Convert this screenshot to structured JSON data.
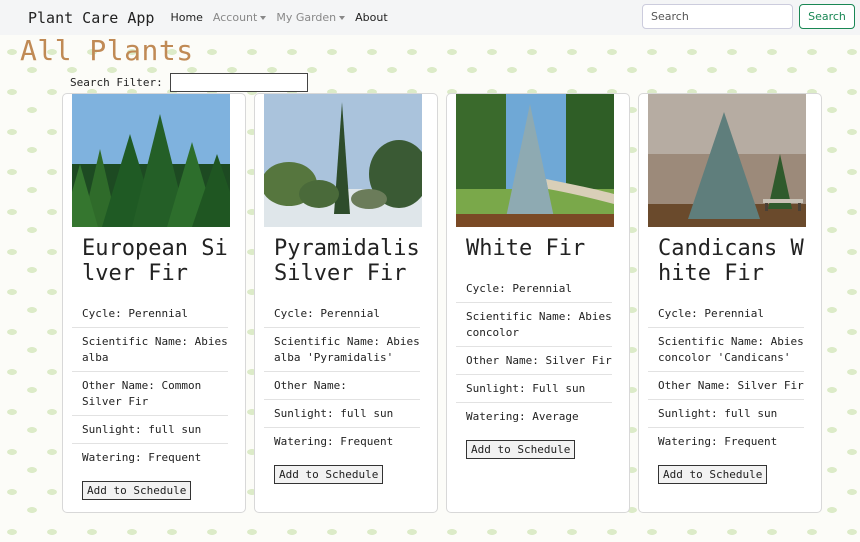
{
  "navbar": {
    "brand": "Plant Care App",
    "links": [
      {
        "label": "Home"
      },
      {
        "label": "Account"
      },
      {
        "label": "My Garden"
      },
      {
        "label": "About"
      }
    ],
    "search_placeholder": "Search",
    "search_button": "Search",
    "accent_color": "#198754"
  },
  "page": {
    "title": "All Plants",
    "title_color": "#c08a55",
    "filter_label": "Search Filter:",
    "filter_value": ""
  },
  "plants": [
    {
      "name": "European Silver Fir",
      "image_icon": "fir-forest-photo",
      "cycle": "Cycle: Perennial",
      "scientific": "Scientific Name: Abies alba",
      "other": "Other Name: Common Silver Fir",
      "sunlight": "Sunlight: full sun",
      "watering": "Watering: Frequent",
      "button": "Add to Schedule"
    },
    {
      "name": "Pyramidalis Silver Fir",
      "image_icon": "snowy-garden-fir-photo",
      "cycle": "Cycle: Perennial",
      "scientific": "Scientific Name: Abies alba 'Pyramidalis'",
      "other": "Other Name:",
      "sunlight": "Sunlight: full sun",
      "watering": "Watering: Frequent",
      "button": "Add to Schedule"
    },
    {
      "name": "White Fir",
      "image_icon": "blue-fir-path-photo",
      "cycle": "Cycle: Perennial",
      "scientific": "Scientific Name: Abies concolor",
      "other": "Other Name: Silver Fir",
      "sunlight": "Sunlight: Full sun",
      "watering": "Watering: Average",
      "button": "Add to Schedule"
    },
    {
      "name": "Candicans White Fir",
      "image_icon": "fir-with-bench-photo",
      "cycle": "Cycle: Perennial",
      "scientific": "Scientific Name: Abies concolor 'Candicans'",
      "other": "Other Name: Silver Fir",
      "sunlight": "Sunlight: full sun",
      "watering": "Watering: Frequent",
      "button": "Add to Schedule"
    }
  ]
}
